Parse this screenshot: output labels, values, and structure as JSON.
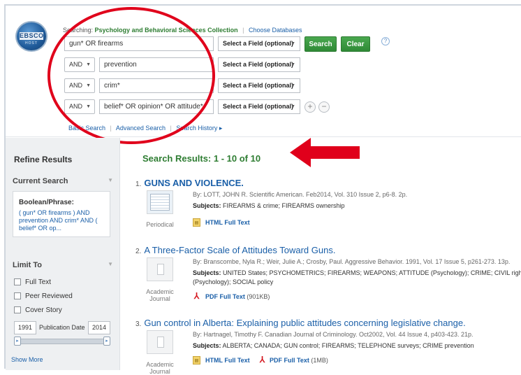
{
  "search": {
    "searching_label": "Searching:",
    "collection": "Psychology and Behavioral Sciences Collection",
    "choose_databases": "Choose Databases",
    "rows": [
      {
        "bool": "",
        "term": "gun* OR firearms",
        "field": "Select a Field (optional)"
      },
      {
        "bool": "AND",
        "term": "prevention",
        "field": "Select a Field (optional)"
      },
      {
        "bool": "AND",
        "term": "crim*",
        "field": "Select a Field (optional)"
      },
      {
        "bool": "AND",
        "term": "belief* OR opinion* OR attitude*",
        "field": "Select a Field (optional)"
      }
    ],
    "search_button": "Search",
    "clear_button": "Clear",
    "help": "?",
    "add": "+",
    "remove": "−",
    "links": {
      "basic": "Basic Search",
      "advanced": "Advanced Search",
      "history": "Search History ▸"
    }
  },
  "logo": {
    "text": "EBSCO",
    "sub": "HOST"
  },
  "sidebar": {
    "title": "Refine Results",
    "current_search": "Current Search",
    "boolean_label": "Boolean/Phrase:",
    "boolean_query": "( gun* OR firearms ) AND prevention AND crim* AND ( belief* OR op...",
    "limit_to": "Limit To",
    "limits": [
      "Full Text",
      "Peer Reviewed",
      "Cover Story"
    ],
    "date_from": "1991",
    "date_label": "Publication Date",
    "date_to": "2014",
    "show_more": "Show More"
  },
  "results": {
    "heading": "Search Results: 1 - 10 of 10",
    "items": [
      {
        "num": "1.",
        "title_html": "GUNS AND VIOLENCE.",
        "byline": "By: LOTT, JOHN R. Scientific American. Feb2014, Vol. 310 Issue 2, p6-8. 2p.",
        "subjects_label": "Subjects:",
        "subjects": "FIREARMS & crime; FIREARMS ownership",
        "type": "Periodical",
        "links": [
          {
            "kind": "html",
            "label": "HTML Full Text",
            "size": ""
          }
        ]
      },
      {
        "num": "2.",
        "title": "A Three-Factor Scale of Attitudes Toward Guns.",
        "byline": "By: Branscombe, Nyla R.; Weir, Julie A.; Crosby, Paul. Aggressive Behavior. 1991, Vol. 17 Issue 5, p261-273. 13p.",
        "subjects_label": "Subjects:",
        "subjects": "UNITED States; PSYCHOMETRICS; FIREARMS; WEAPONS; ATTITUDE (Psychology); CRIME; CIVIL rights;",
        "subjects2": "(Psychology); SOCIAL policy",
        "type": "Academic Journal",
        "links": [
          {
            "kind": "pdf",
            "label": "PDF Full Text",
            "size": "(901KB)"
          }
        ]
      },
      {
        "num": "3.",
        "title": "Gun control in Alberta: Explaining public attitudes concerning legislative change.",
        "byline": "By: Hartnagel, Timothy F. Canadian Journal of Criminology. Oct2002, Vol. 44 Issue 4, p403-423. 21p.",
        "subjects_label": "Subjects:",
        "subjects": "ALBERTA; CANADA; GUN control; FIREARMS; TELEPHONE surveys; CRIME prevention",
        "type": "Academic Journal",
        "links": [
          {
            "kind": "html",
            "label": "HTML Full Text",
            "size": ""
          },
          {
            "kind": "pdf",
            "label": "PDF Full Text",
            "size": "(1MB)"
          }
        ]
      }
    ]
  },
  "colors": {
    "accent_green": "#2e7d32",
    "link_blue": "#1a5fa8",
    "annotation_red": "#e0001b"
  }
}
